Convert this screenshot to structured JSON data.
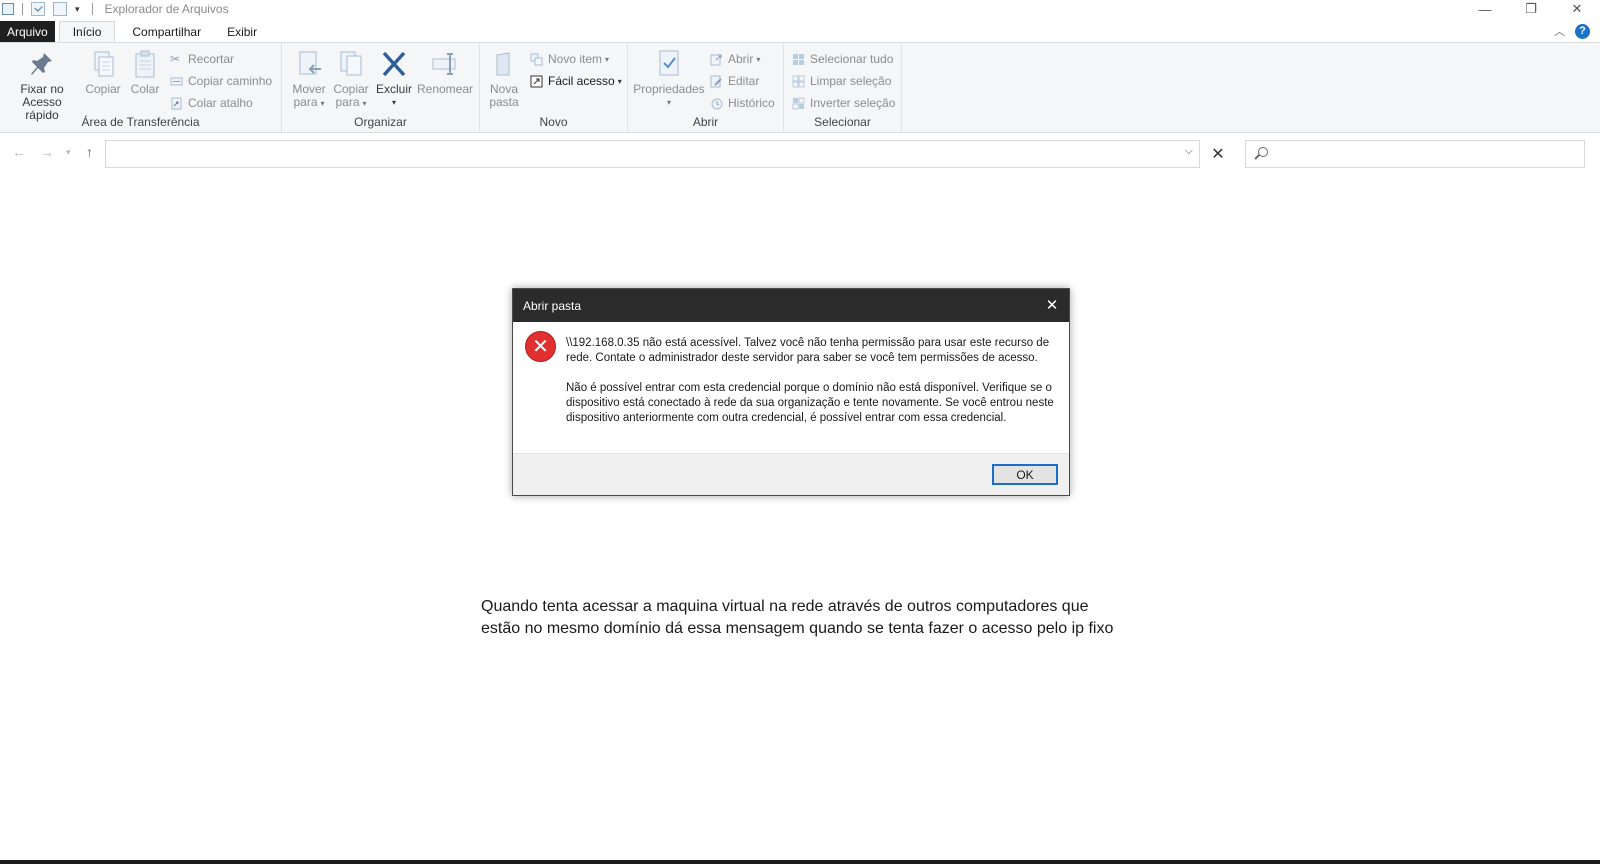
{
  "window": {
    "title": "Explorador de Arquivos",
    "controls": {
      "minimize": "—",
      "restore": "❐",
      "close": "✕"
    }
  },
  "tabs": {
    "file": "Arquivo",
    "home": "Início",
    "share": "Compartilhar",
    "view": "Exibir"
  },
  "ribbon": {
    "clipboard": {
      "label": "Área de Transferência",
      "pin_line1": "Fixar no",
      "pin_line2": "Acesso rápido",
      "copy": "Copiar",
      "paste": "Colar",
      "cut": "Recortar",
      "copy_path": "Copiar caminho",
      "paste_shortcut": "Colar atalho"
    },
    "organize": {
      "label": "Organizar",
      "move_line1": "Mover",
      "move_line2": "para",
      "copyto_line1": "Copiar",
      "copyto_line2": "para",
      "delete": "Excluir",
      "rename": "Renomear"
    },
    "new": {
      "label": "Novo",
      "new_folder_line1": "Nova",
      "new_folder_line2": "pasta",
      "new_item": "Novo item",
      "easy_access": "Fácil acesso"
    },
    "open": {
      "label": "Abrir",
      "properties": "Propriedades",
      "open": "Abrir",
      "edit": "Editar",
      "history": "Histórico"
    },
    "select": {
      "label": "Selecionar",
      "select_all": "Selecionar tudo",
      "select_none": "Limpar seleção",
      "invert": "Inverter seleção"
    }
  },
  "address_bar": {
    "value": ""
  },
  "search_box": {
    "value": ""
  },
  "dialog": {
    "title": "Abrir pasta",
    "message_1": "\\\\192.168.0.35 não está acessível. Talvez você não tenha permissão para usar este recurso de rede. Contate o administrador deste servidor para saber se você tem permissões de acesso.",
    "message_2": "Não é possível entrar com esta credencial porque o domínio não está disponível. Verifique se o dispositivo está conectado à rede da sua organização e tente novamente. Se você entrou neste dispositivo anteriormente com outra credencial, é possível entrar com essa credencial.",
    "ok": "OK"
  },
  "caption": "Quando tenta acessar a maquina virtual na rede através de outros computadores que estão no mesmo domínio dá essa mensagem quando se tenta fazer o acesso pelo ip fixo",
  "colors": {
    "accent": "#1c6ec9",
    "error": "#e0302f",
    "dialog_title_bg": "#2b2b2b"
  }
}
